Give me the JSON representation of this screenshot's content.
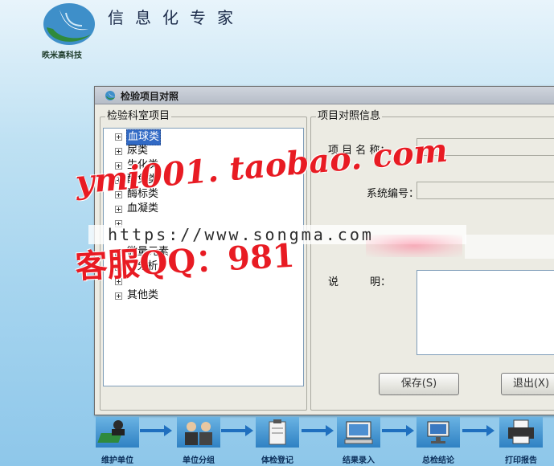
{
  "header": {
    "company": "昳米高科技",
    "app_title": "信息化专家"
  },
  "dialog": {
    "title": "检验项目对照",
    "left_group": {
      "label": "检验科室项目",
      "tree": [
        {
          "label": "血球类",
          "selected": true
        },
        {
          "label": "尿类"
        },
        {
          "label": "生化类"
        },
        {
          "label": "酶免类"
        },
        {
          "label": "酶标类"
        },
        {
          "label": "血凝类"
        },
        {
          "label": ""
        },
        {
          "label": "微量元素"
        },
        {
          "label": "...分析"
        },
        {
          "label": ""
        },
        {
          "label": "其他类"
        }
      ]
    },
    "right_group": {
      "label": "项目对照信息",
      "fields": {
        "name_label": "项 目 名 称：",
        "code_label": "系统编号：",
        "desc_label": "说　　　明："
      },
      "buttons": {
        "save": "保存(S)",
        "exit": "退出(X)"
      }
    }
  },
  "workflow": {
    "steps": [
      {
        "label": "维护单位",
        "icon": "book-user-icon"
      },
      {
        "label": "单位分组",
        "icon": "group-people-icon"
      },
      {
        "label": "体检登记",
        "icon": "clipboard-icon"
      },
      {
        "label": "结果录入",
        "icon": "computer-icon"
      },
      {
        "label": "总检结论",
        "icon": "monitor-icon"
      },
      {
        "label": "打印报告",
        "icon": "printer-icon"
      }
    ]
  },
  "watermark": {
    "url": "https://www.songma.com",
    "shop": "ymi001. taobao. com",
    "qq": "客服QQ：981"
  },
  "colors": {
    "selection": "#316ac5",
    "dialog_bg": "#ecebe3",
    "watermark_red": "#e81b23",
    "tile_blue": "#2f81c3"
  }
}
